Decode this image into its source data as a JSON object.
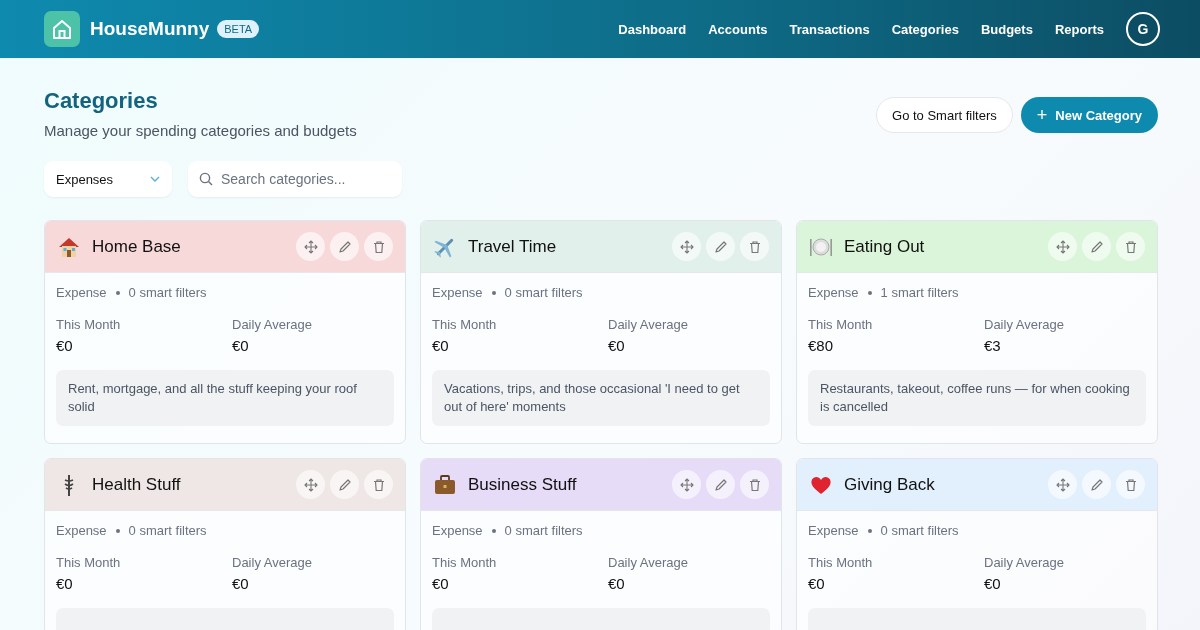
{
  "brand": {
    "name": "HouseMunny",
    "badge": "BETA"
  },
  "nav": [
    "Dashboard",
    "Accounts",
    "Transactions",
    "Categories",
    "Budgets",
    "Reports"
  ],
  "avatar": "G",
  "page": {
    "title": "Categories",
    "subtitle": "Manage your spending categories and budgets"
  },
  "actions": {
    "secondary": "Go to Smart filters",
    "primary": "New Category",
    "primary_icon": "+"
  },
  "filter": {
    "value": "Expenses"
  },
  "search": {
    "placeholder": "Search categories..."
  },
  "categories": [
    {
      "name": "Home Base",
      "color": "#f7d9da",
      "type": "Expense",
      "filters": "0 smart filters",
      "month_label": "This Month",
      "month": "€0",
      "avg_label": "Daily Average",
      "avg": "€0",
      "description": "Rent, mortgage, and all the stuff keeping your roof solid"
    },
    {
      "name": "Travel Time",
      "color": "#e1f0ea",
      "type": "Expense",
      "filters": "0 smart filters",
      "month_label": "This Month",
      "month": "€0",
      "avg_label": "Daily Average",
      "avg": "€0",
      "description": "Vacations, trips, and those occasional 'I need to get out of here' moments"
    },
    {
      "name": "Eating Out",
      "color": "#daf5d9",
      "type": "Expense",
      "filters": "1 smart filters",
      "month_label": "This Month",
      "month": "€80",
      "avg_label": "Daily Average",
      "avg": "€3",
      "description": "Restaurants, takeout, coffee runs — for when cooking is cancelled"
    },
    {
      "name": "Health Stuff",
      "color": "#efe7e6",
      "type": "Expense",
      "filters": "0 smart filters",
      "month_label": "This Month",
      "month": "€0",
      "avg_label": "Daily Average",
      "avg": "€0"
    },
    {
      "name": "Business Stuff",
      "color": "#e6dcf8",
      "type": "Expense",
      "filters": "0 smart filters",
      "month_label": "This Month",
      "month": "€0",
      "avg_label": "Daily Average",
      "avg": "€0"
    },
    {
      "name": "Giving Back",
      "color": "#e2effd",
      "type": "Expense",
      "filters": "0 smart filters",
      "month_label": "This Month",
      "month": "€0",
      "avg_label": "Daily Average",
      "avg": "€0"
    }
  ]
}
